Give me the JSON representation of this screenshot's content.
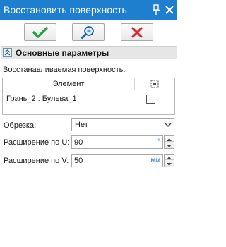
{
  "window": {
    "title": "Восстановить поверхность"
  },
  "icons": {
    "pin": "pin-icon",
    "close": "close-icon",
    "ok": "checkmark-icon",
    "preview": "preview-magnifier-icon",
    "cancel": "cancel-x-icon",
    "collapse": "chevron-up-icon",
    "column": "selection-box-icon",
    "dropdown": "chevron-down-icon"
  },
  "colors": {
    "title_bar": "#1d7fce",
    "ok_icon": "#1fa63a",
    "cancel_icon": "#d9232e",
    "unit": "#1d7fce"
  },
  "section": {
    "label": "Основные параметры"
  },
  "surface": {
    "label": "Восстанавливаемая поверхность:",
    "columns": {
      "element": "Элемент"
    },
    "rows": [
      {
        "name": "Грань_2 : Булева_1",
        "checked": false
      }
    ]
  },
  "trim": {
    "label": "Обрезка:",
    "value": "Нет"
  },
  "extend_u": {
    "label": "Расширение по U:",
    "value": "90",
    "unit": "°"
  },
  "extend_v": {
    "label": "Расширение по V:",
    "value": "50",
    "unit": "мм"
  }
}
